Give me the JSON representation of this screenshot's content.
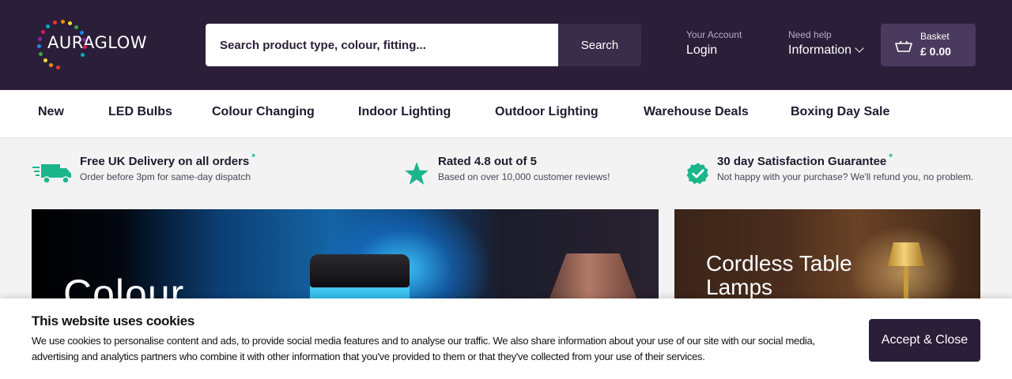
{
  "header": {
    "logo_text": "AURAGLOW",
    "logo_dot_colors": [
      "#e53935",
      "#fb8c00",
      "#fdd835",
      "#43a047",
      "#1e88e5",
      "#8e24aa",
      "#d81b60",
      "#00acc1"
    ],
    "search": {
      "placeholder": "Search product type, colour, fitting...",
      "button_label": "Search"
    },
    "account": {
      "small": "Your Account",
      "big": "Login"
    },
    "help": {
      "small": "Need help",
      "big": "Information"
    },
    "basket": {
      "label": "Basket",
      "total": "£ 0.00",
      "icon": "basket-icon"
    }
  },
  "nav": {
    "items": [
      {
        "label": "New"
      },
      {
        "label": "LED Bulbs"
      },
      {
        "label": "Colour Changing"
      },
      {
        "label": "Indoor Lighting"
      },
      {
        "label": "Outdoor Lighting"
      },
      {
        "label": "Warehouse Deals"
      },
      {
        "label": "Boxing Day Sale"
      }
    ]
  },
  "usps": [
    {
      "title": "Free UK Delivery on all orders",
      "asterisk": "*",
      "sub": "Order before 3pm for same-day dispatch",
      "icon": "delivery-truck-icon"
    },
    {
      "title": "Rated 4.8 out of 5",
      "sub": "Based on over 10,000 customer reviews!",
      "icon": "star-icon"
    },
    {
      "title": "30 day Satisfaction Guarantee",
      "asterisk": "*",
      "sub": "Not happy with your purchase? We'll refund you, no problem.",
      "icon": "check-badge-icon"
    }
  ],
  "banners": {
    "left": {
      "headline": "Colour"
    },
    "right": {
      "headline": "Cordless Table Lamps"
    }
  },
  "cookie": {
    "title": "This website uses cookies",
    "text": "We use cookies to personalise content and ads, to provide social media features and to analyse our traffic. We also share information about your use of our site with our social media, advertising and analytics partners who combine it with other information that you've provided to them or that they've collected from your use of their services.",
    "button_label": "Accept & Close"
  },
  "colors": {
    "header_bg": "#2a1e38",
    "accent_green": "#1bb58a",
    "basket_bg": "#4a3a5e"
  }
}
